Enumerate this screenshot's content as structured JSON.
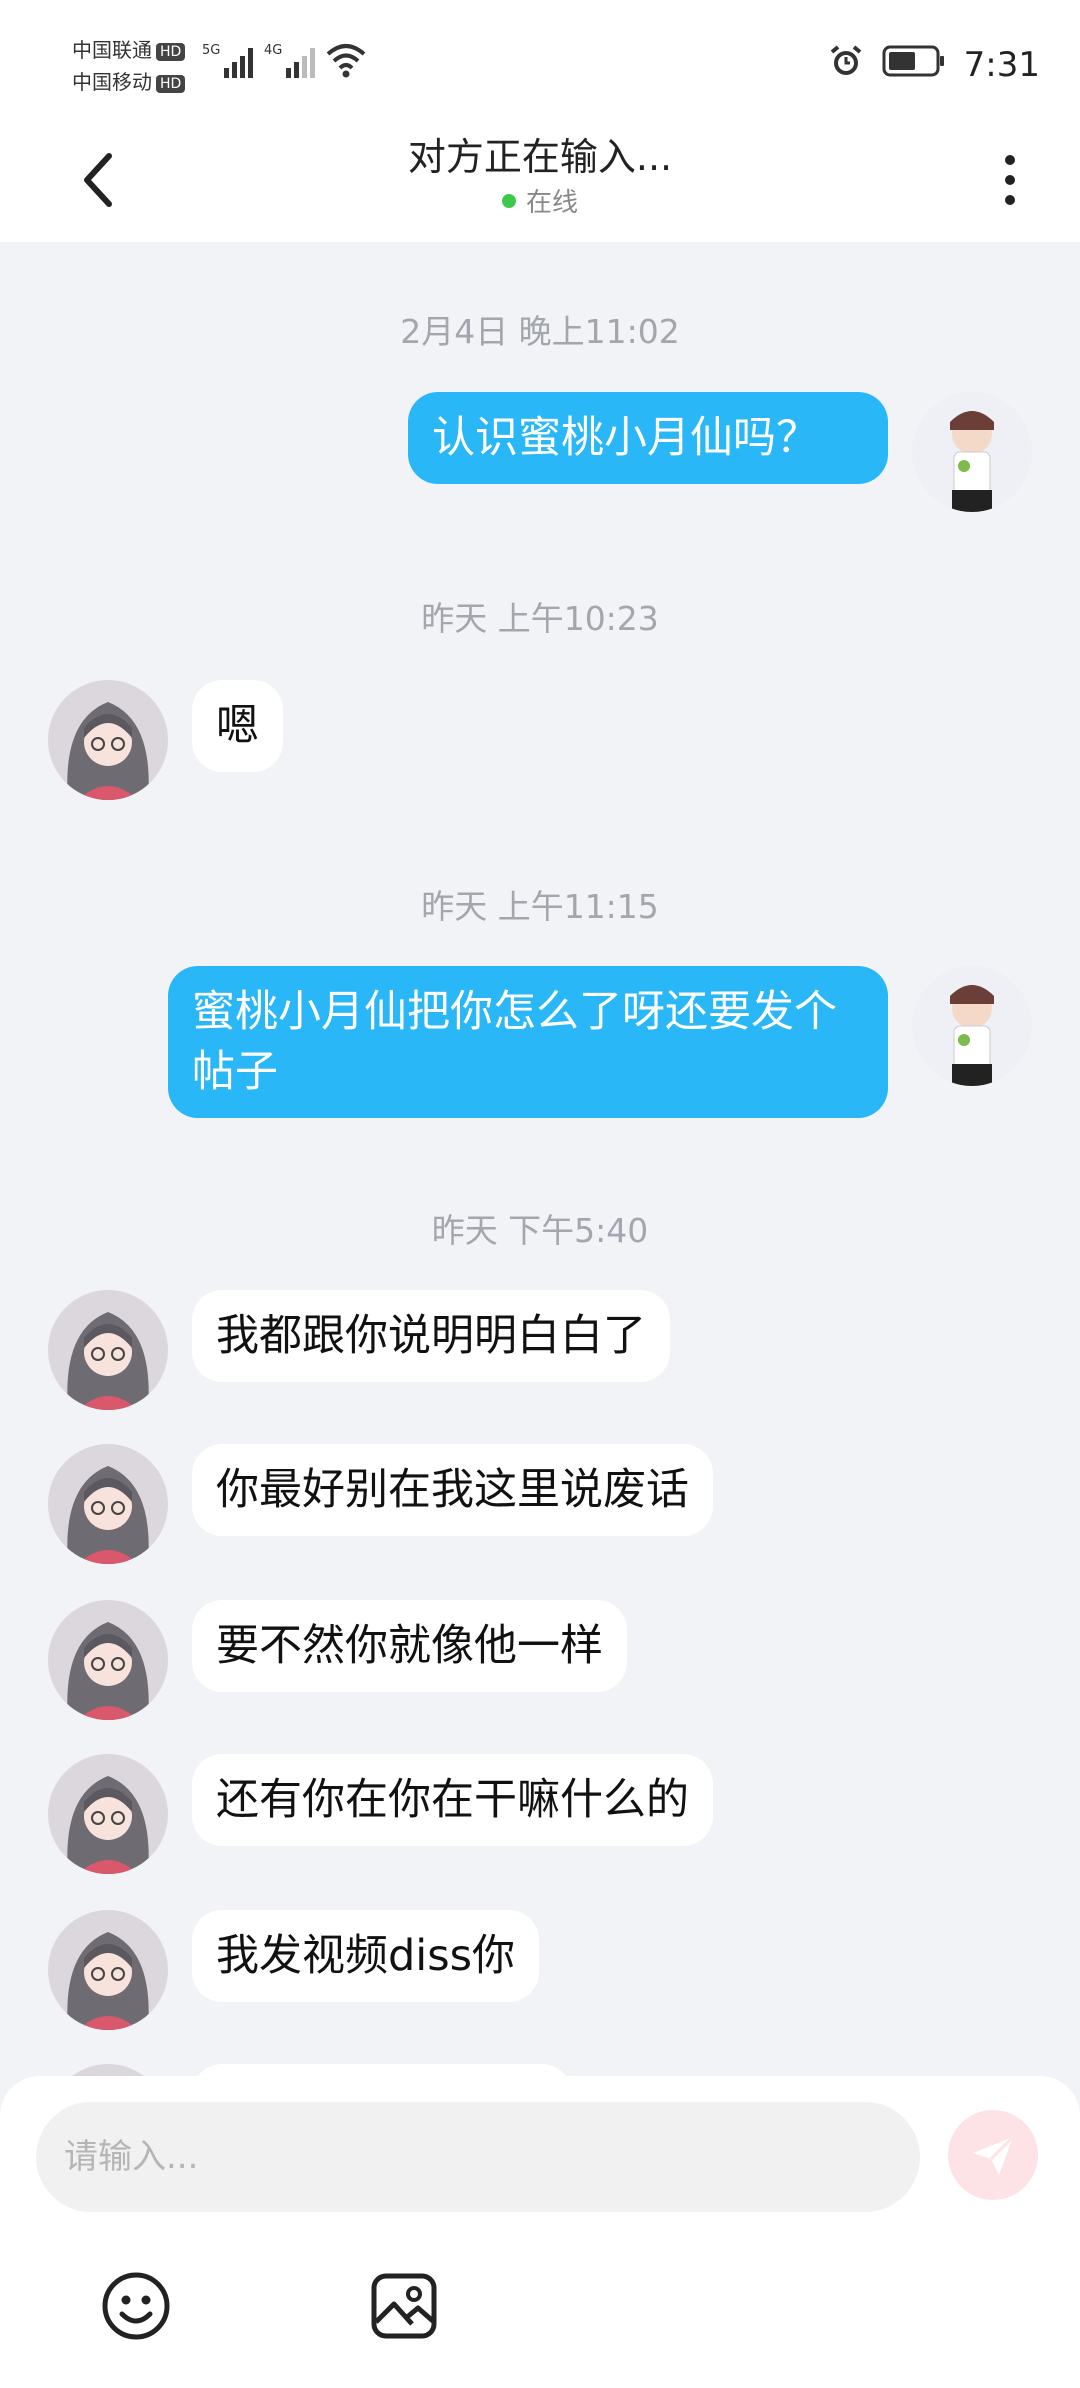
{
  "status_bar": {
    "carrier1": "中国联通",
    "carrier2": "中国移动",
    "hd": "HD",
    "net1": "5G",
    "net2": "4G",
    "time": "7:31",
    "icons": [
      "signal-icon",
      "wifi-icon",
      "alarm-icon",
      "battery-icon"
    ]
  },
  "header": {
    "title": "对方正在输入...",
    "status": "在线",
    "online_color": "#3cc84a"
  },
  "messages": [
    {
      "type": "time",
      "text": "2月4日 晚上11:02"
    },
    {
      "type": "me",
      "text": "认识蜜桃小月仙吗？"
    },
    {
      "type": "time",
      "text": "昨天 上午10:23"
    },
    {
      "type": "other",
      "text": "嗯"
    },
    {
      "type": "time",
      "text": "昨天 上午11:15"
    },
    {
      "type": "me",
      "text": "蜜桃小月仙把你怎么了呀还要发个帖子"
    },
    {
      "type": "time",
      "text": "昨天 下午5:40"
    },
    {
      "type": "other",
      "text": "我都跟你说明明白白了"
    },
    {
      "type": "other",
      "text": "你最好别在我这里说废话"
    },
    {
      "type": "other",
      "text": "要不然你就像他一样"
    },
    {
      "type": "other",
      "text": "还有你在你在干嘛什么的"
    },
    {
      "type": "other",
      "text": "我发视频diss你"
    }
  ],
  "input": {
    "placeholder": "请输入...",
    "send_icon": "send-icon",
    "tools": [
      "emoji-icon",
      "image-icon"
    ]
  },
  "colors": {
    "my_bubble": "#29b7f8",
    "their_bubble": "#ffffff",
    "background": "#f2f3f7",
    "send_button": "#fde3e6"
  }
}
